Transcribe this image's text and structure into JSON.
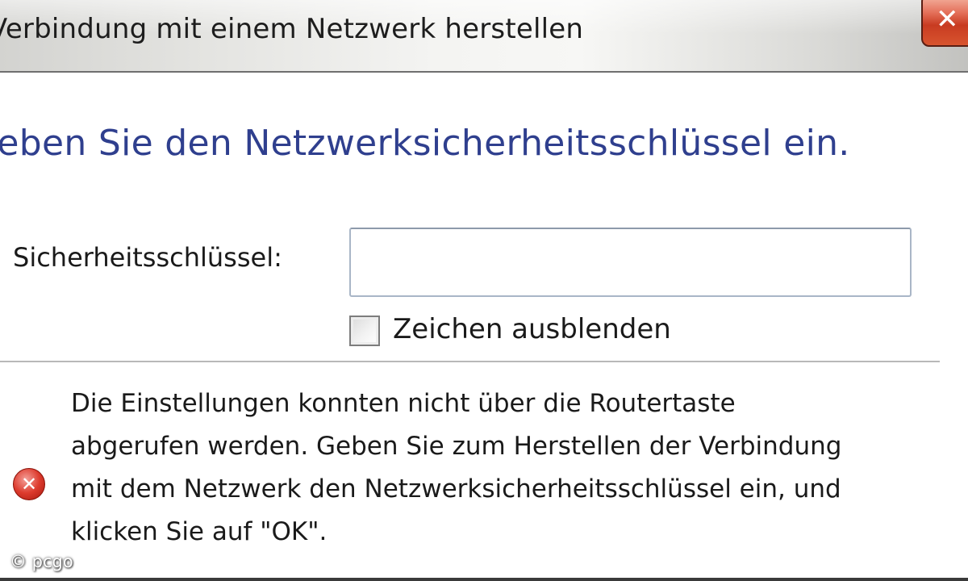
{
  "window": {
    "title": "Verbindung mit einem Netzwerk herstellen",
    "close_glyph": "✕",
    "close_icon": "close-icon"
  },
  "instruction": "Geben Sie den Netzwerksicherheitsschlüssel ein.",
  "form": {
    "key_label": "Sicherheitsschlüssel:",
    "key_value": "",
    "hide_chars_label": "Zeichen ausblenden",
    "hide_chars_checked": false
  },
  "error": {
    "icon": "error-icon",
    "lines": [
      "Die Einstellungen konnten nicht über die Routertaste",
      "abgerufen werden. Geben Sie zum Herstellen der Verbindung",
      "mit dem Netzwerk den Netzwerksicherheitsschlüssel ein, und",
      "klicken Sie auf \"OK\"."
    ]
  },
  "watermark": "© pcgo",
  "colors": {
    "instruction": "#2f3f8e",
    "close_button": "#c83b21",
    "error_icon": "#dd3b2e"
  }
}
